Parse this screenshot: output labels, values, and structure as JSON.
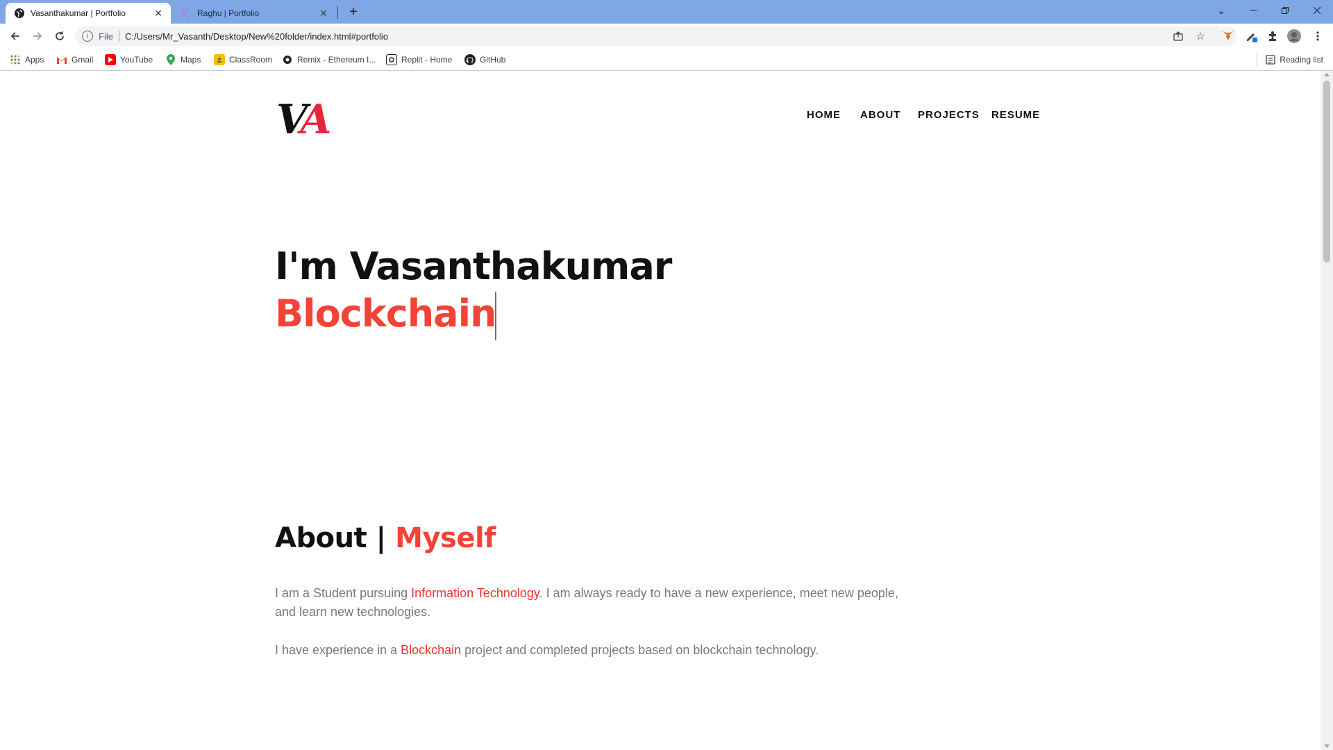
{
  "browser": {
    "tabs": [
      {
        "title": "Vasanthakumar | Portfolio",
        "active": true
      },
      {
        "title": "Raghu | Portfolio",
        "active": false
      }
    ],
    "new_tab_label": "+",
    "address": {
      "scheme": "File",
      "url": "C:/Users/Mr_Vasanth/Desktop/New%20folder/index.html#portfolio"
    },
    "bookmarks": [
      {
        "label": "Apps",
        "icon": "apps-grid-icon"
      },
      {
        "label": "Gmail",
        "icon": "gmail-icon"
      },
      {
        "label": "YouTube",
        "icon": "youtube-icon"
      },
      {
        "label": "Maps",
        "icon": "maps-icon"
      },
      {
        "label": "ClassRoom",
        "icon": "classroom-icon"
      },
      {
        "label": "Remix - Ethereum I...",
        "icon": "remix-icon"
      },
      {
        "label": "Replit - Home",
        "icon": "replit-icon"
      },
      {
        "label": "GitHub",
        "icon": "github-icon"
      }
    ],
    "reading_list": "Reading list"
  },
  "site": {
    "logo": {
      "first": "V",
      "second": "A"
    },
    "nav": [
      "HOME",
      "ABOUT",
      "PROJECTS",
      "RESUME"
    ],
    "hero": {
      "line1": "I'm Vasanthakumar",
      "line2": "Blockchain"
    },
    "about": {
      "title_black": "About | ",
      "title_red": "Myself",
      "p1_a": "I am a Student pursuing ",
      "p1_hl": "Information Technology",
      "p1_b": ". I am always ready to have a new experience, meet new people, and learn new technologies.",
      "p2_a": "I have experience in a ",
      "p2_hl": "Blockchain",
      "p2_b": " project and completed projects based on blockchain technology."
    }
  },
  "colors": {
    "accent": "#f24336",
    "text": "#111111",
    "muted": "#787878",
    "tabstrip": "#7fa7e6"
  }
}
